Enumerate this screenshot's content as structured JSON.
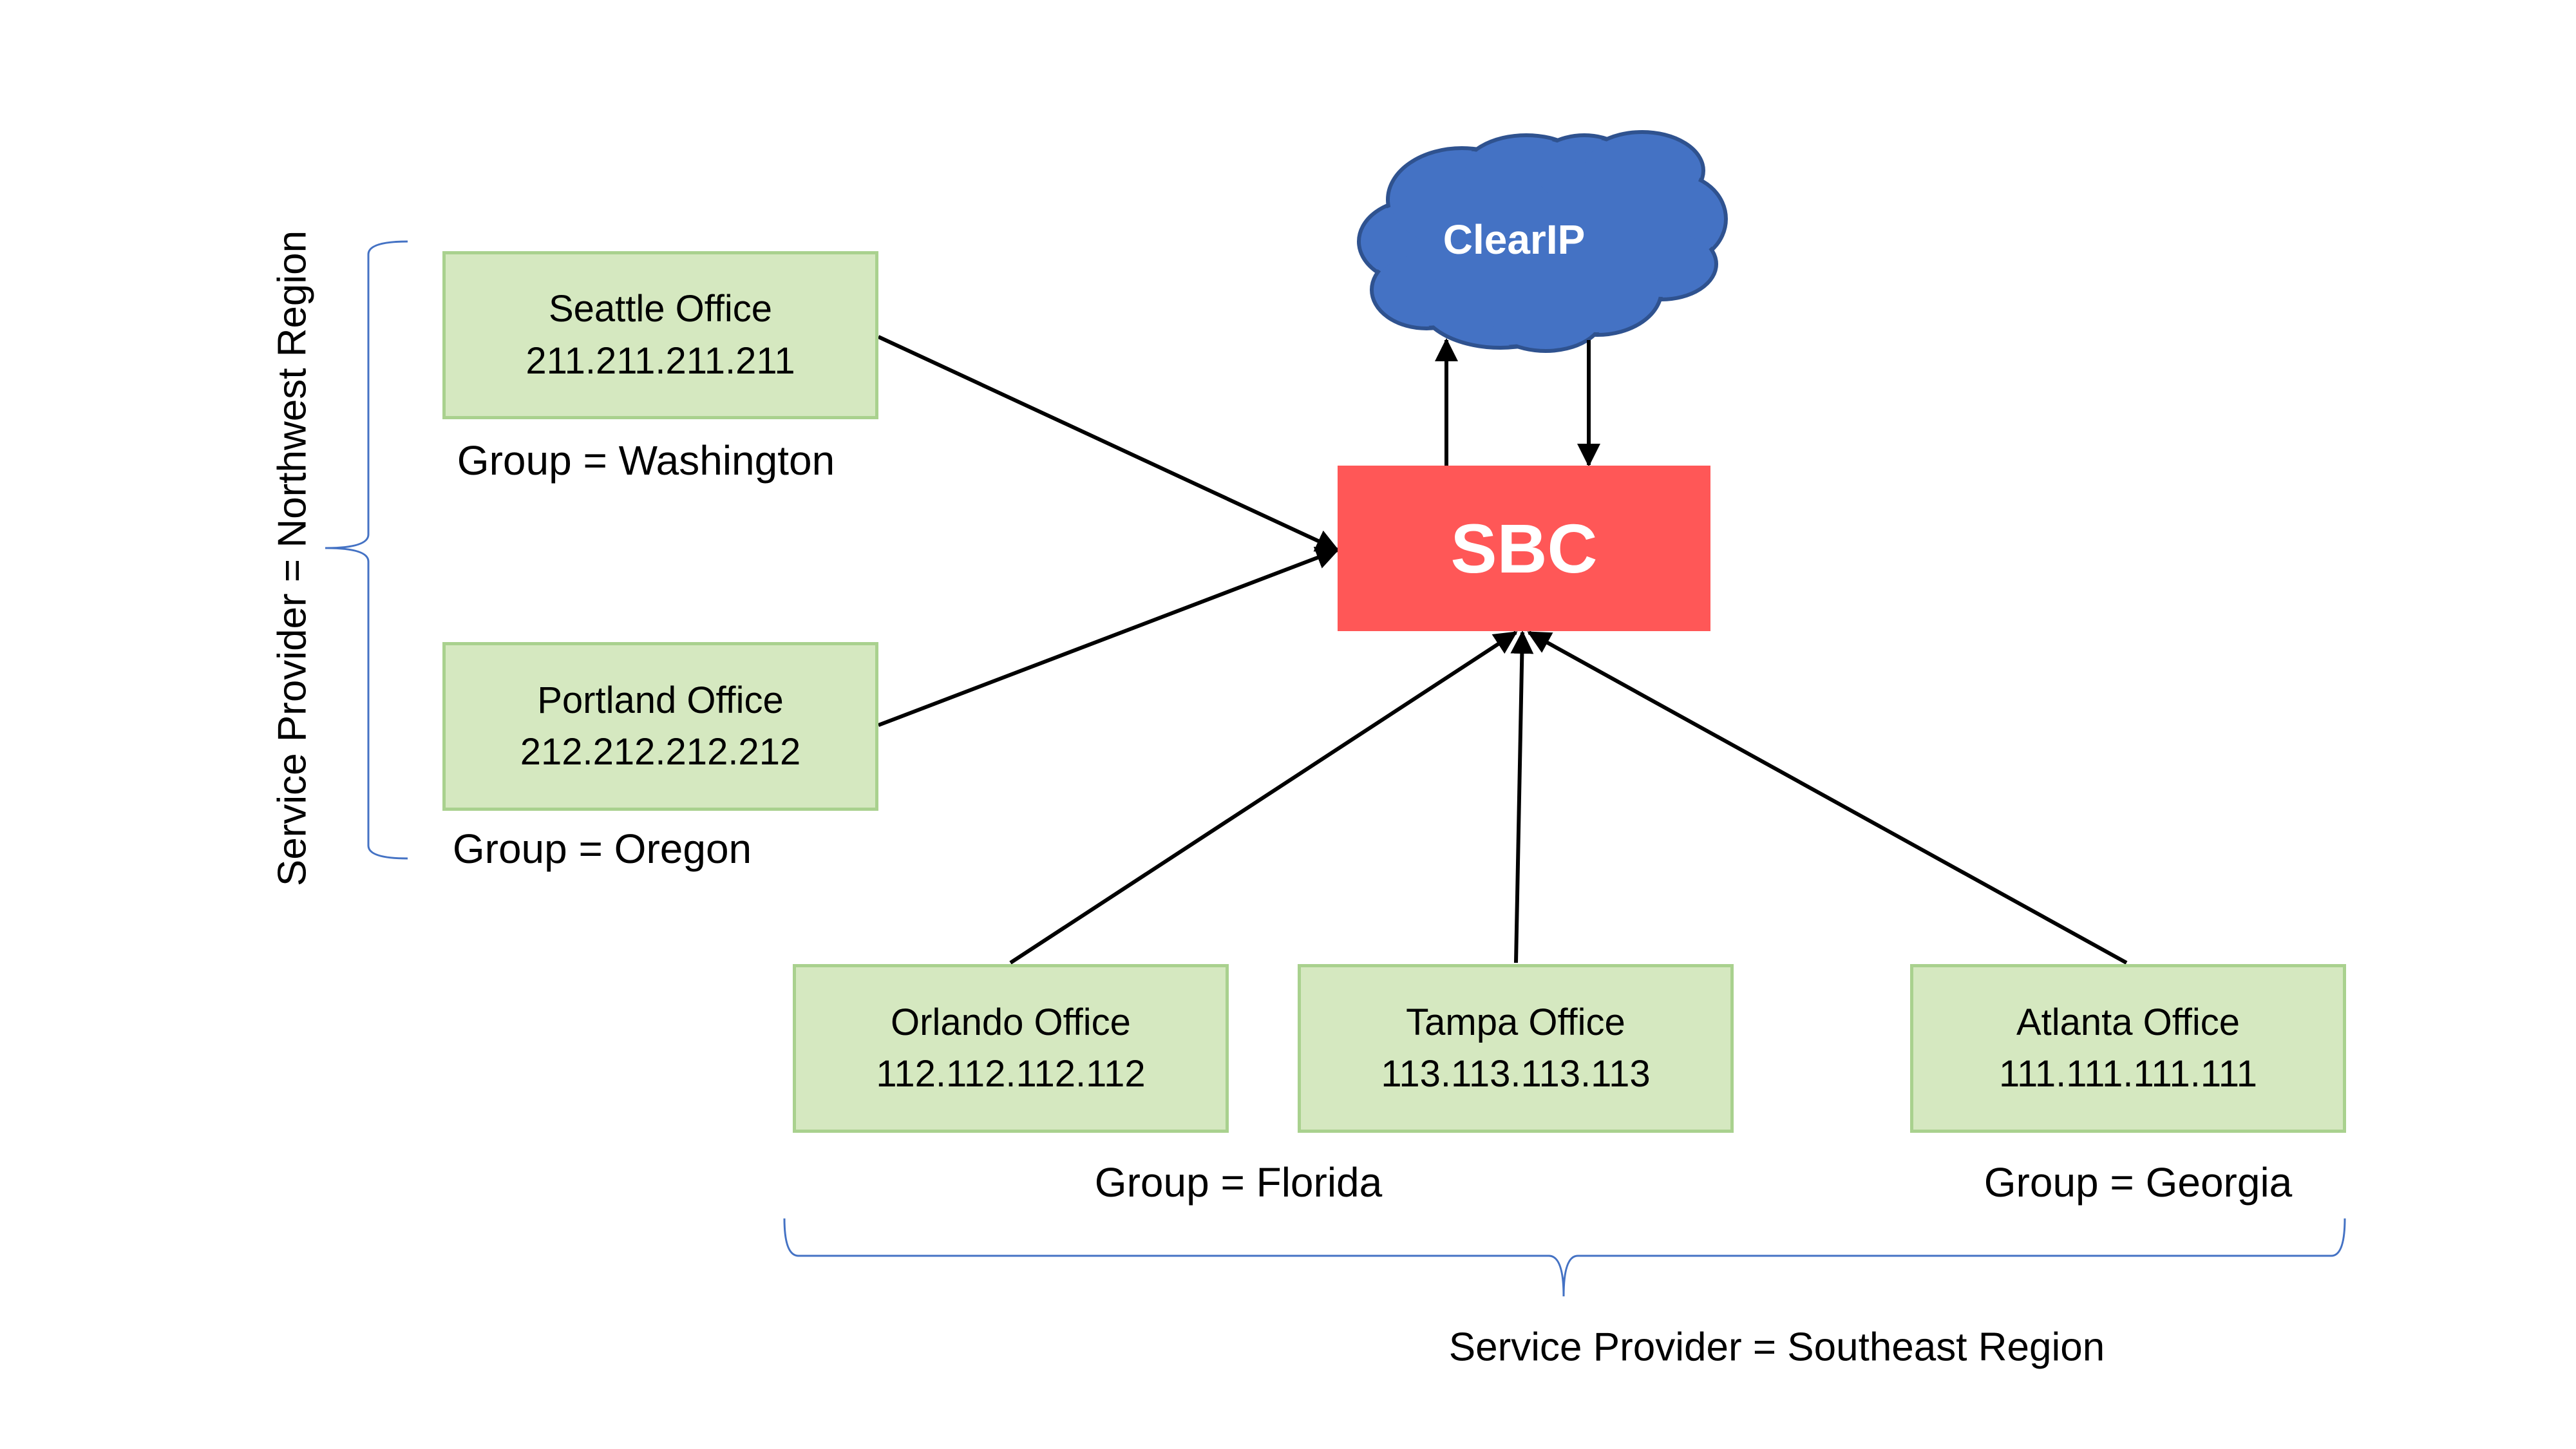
{
  "cloud": {
    "label": "ClearIP",
    "fill": "#4472C4",
    "stroke": "#2F528F"
  },
  "sbc": {
    "label": "SBC",
    "fill": "#FF5757"
  },
  "offices": [
    {
      "name": "Seattle Office",
      "ip": "211.211.211.211"
    },
    {
      "name": "Portland Office",
      "ip": "212.212.212.212"
    },
    {
      "name": "Orlando Office",
      "ip": "112.112.112.112"
    },
    {
      "name": "Tampa Office",
      "ip": "113.113.113.113"
    },
    {
      "name": "Atlanta Office",
      "ip": "111.111.111.111"
    }
  ],
  "groups": {
    "washington": "Group = Washington",
    "oregon": "Group = Oregon",
    "florida": "Group = Florida",
    "georgia": "Group = Georgia"
  },
  "regions": {
    "northwest": "Service Provider = Northwest Region",
    "southeast": "Service Provider = Southeast Region"
  },
  "colors": {
    "office_fill": "#D5E8C0",
    "office_border": "#A9D18E",
    "brace": "#4472C4"
  }
}
